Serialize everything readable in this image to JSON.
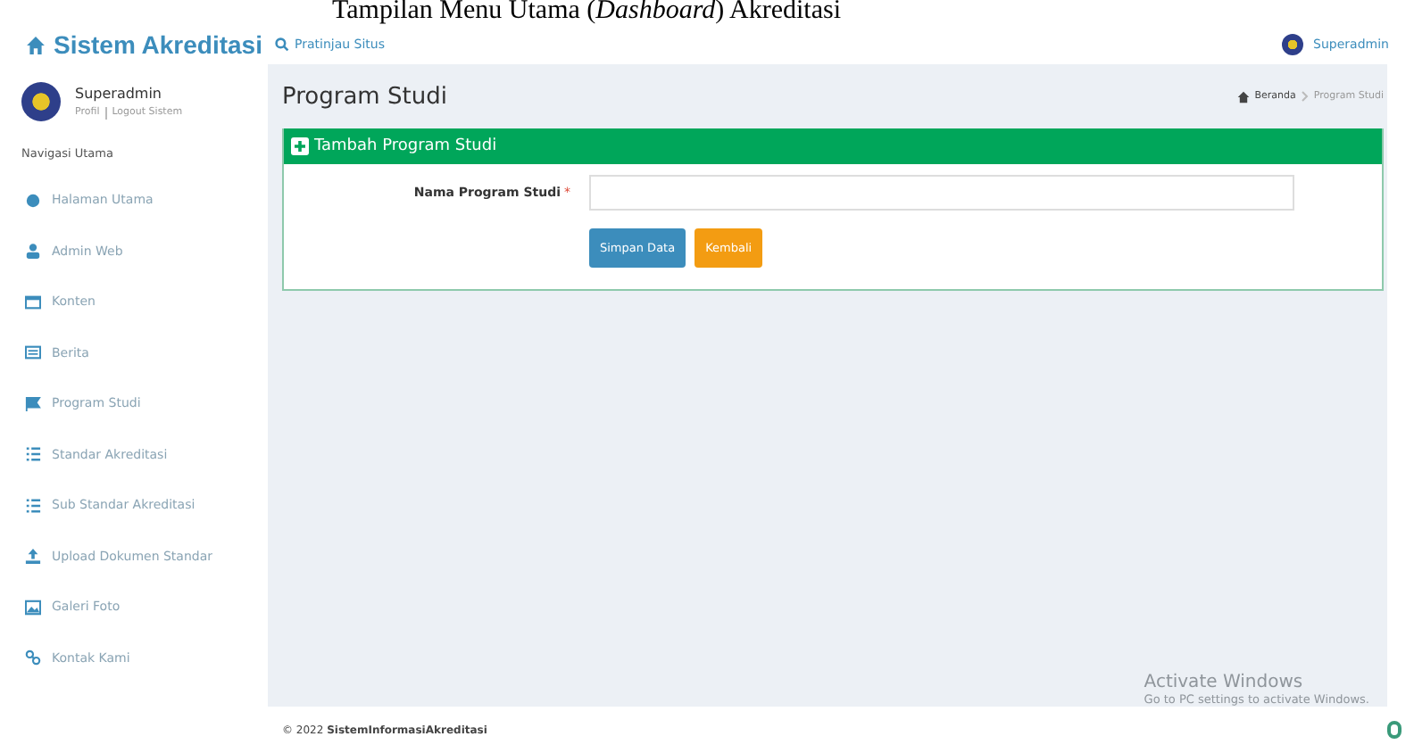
{
  "caption": {
    "before": "Tampilan Menu Utama (",
    "emphasis": "Dashboard",
    "after": ") Akreditasi"
  },
  "header": {
    "brand": "Sistem Akreditasi",
    "preview_link": "Pratinjau Situs",
    "user": "Superadmin"
  },
  "sidebar": {
    "user": {
      "name": "Superadmin",
      "links": [
        "Profil",
        "Logout Sistem"
      ]
    },
    "section_title": "Navigasi Utama",
    "items": [
      {
        "label": "Halaman Utama"
      },
      {
        "label": "Admin Web"
      },
      {
        "label": "Konten"
      },
      {
        "label": "Berita"
      },
      {
        "label": "Program Studi"
      },
      {
        "label": "Standar Akreditasi"
      },
      {
        "label": "Sub Standar Akreditasi"
      },
      {
        "label": "Upload Dokumen Standar"
      },
      {
        "label": "Galeri Foto"
      },
      {
        "label": "Kontak Kami"
      }
    ]
  },
  "page": {
    "title": "Program Studi",
    "breadcrumb": [
      "Beranda",
      "Program Studi"
    ]
  },
  "form": {
    "title": "Tambah Program Studi",
    "field_label": "Nama Program Studi",
    "required_mark": "*",
    "buttons": [
      {
        "label": "Simpan Data",
        "kind": "primary"
      },
      {
        "label": "Kembali",
        "kind": "warning"
      }
    ]
  },
  "footer": {
    "year": "© 2022",
    "name": "SistemInformasiAkreditasi"
  },
  "os_notice": {
    "title": "Activate Windows",
    "subtitle": "Go to PC settings to activate Windows."
  }
}
